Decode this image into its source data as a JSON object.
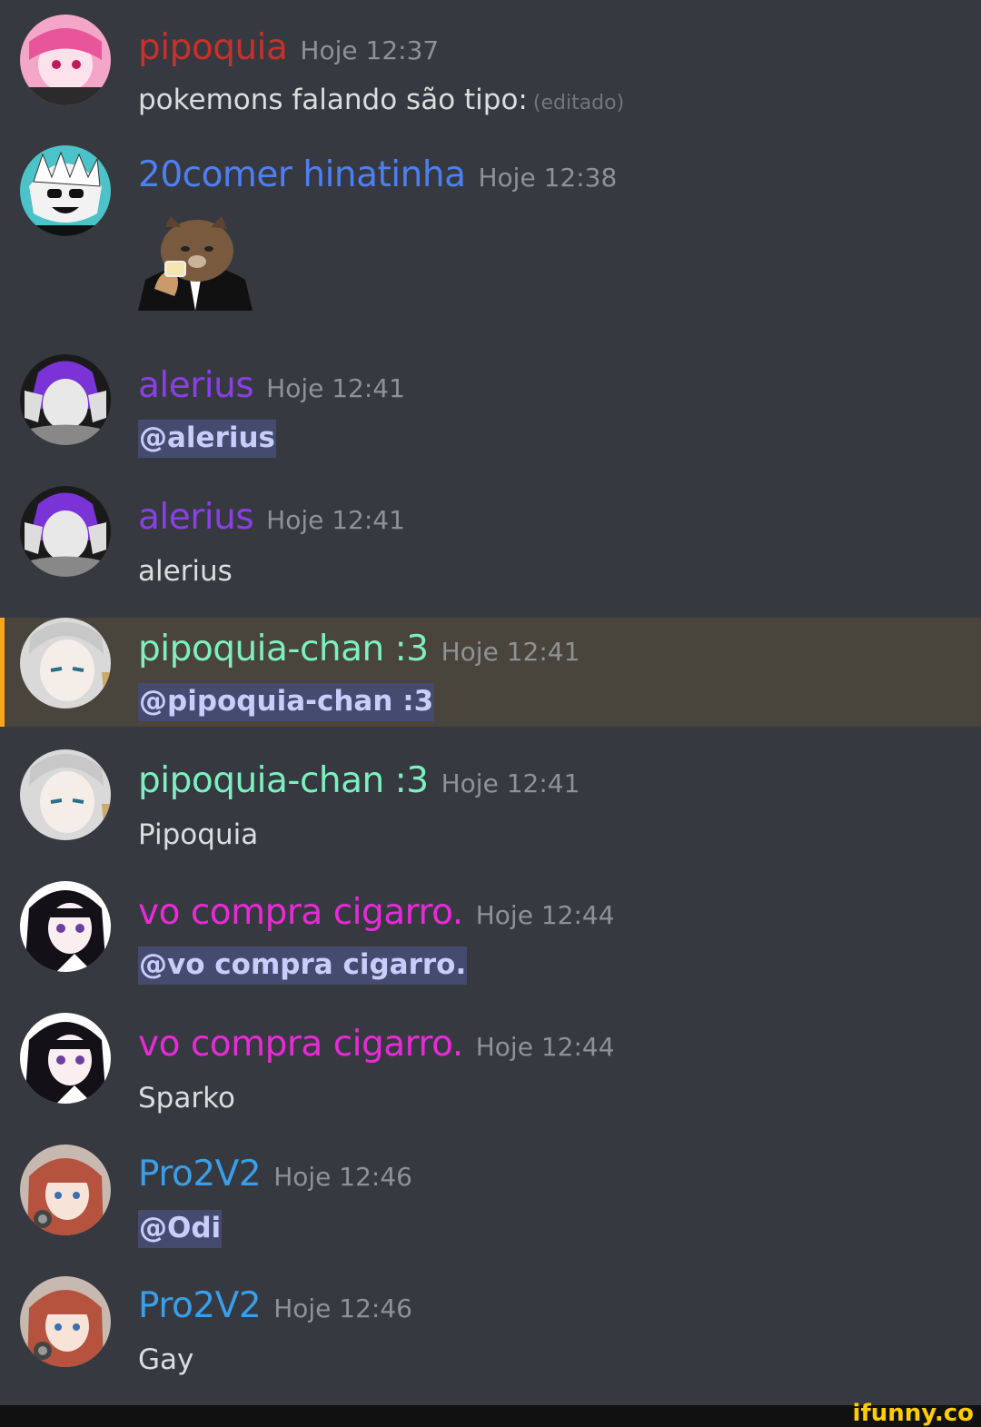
{
  "messages": [
    {
      "username": "pipoquia",
      "name_color": "#c9302c",
      "time": "Hoje 12:37",
      "text": "pokemons falando são tipo:",
      "edited": "(editado)"
    },
    {
      "username": "20comer hinatinha",
      "name_color": "#4e7ff2",
      "time": "Hoje 12:38",
      "sticker": "cat-tuxedo-toast-sticker"
    },
    {
      "username": "alerius",
      "name_color": "#8b3fe6",
      "time": "Hoje 12:41",
      "mention": "@alerius"
    },
    {
      "username": "alerius",
      "name_color": "#8b3fe6",
      "time": "Hoje 12:41",
      "text": "alerius"
    },
    {
      "username": "pipoquia-chan :3",
      "name_color": "#7ef0c0",
      "time": "Hoje 12:41",
      "mention": "@pipoquia-chan :3"
    },
    {
      "username": "pipoquia-chan :3",
      "name_color": "#7ef0c0",
      "time": "Hoje 12:41",
      "text": "Pipoquia"
    },
    {
      "username": "vo compra cigarro.",
      "name_color": "#e92ad8",
      "time": "Hoje 12:44",
      "mention": "@vo compra cigarro."
    },
    {
      "username": "vo compra cigarro.",
      "name_color": "#e92ad8",
      "time": "Hoje 12:44",
      "text": "Sparko"
    },
    {
      "username": "Pro2V2",
      "name_color": "#3a9ee8",
      "time": "Hoje 12:46",
      "mention": "@Odi"
    },
    {
      "username": "Pro2V2",
      "name_color": "#3a9ee8",
      "time": "Hoje 12:46",
      "text": "Gay"
    }
  ],
  "watermark": "ifunny.co"
}
